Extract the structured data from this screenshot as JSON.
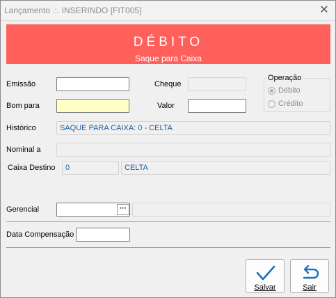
{
  "window": {
    "title": "Lançamento .:. INSERINDO [FIT005]",
    "close_glyph": "✕"
  },
  "banner": {
    "title": "DÉBITO",
    "subtitle": "Saque para Caixa",
    "color": "#ff605c"
  },
  "form": {
    "emissao_label": "Emissão",
    "emissao_value": "",
    "bom_para_label": "Bom para",
    "bom_para_value": "",
    "cheque_label": "Cheque",
    "cheque_value": "",
    "valor_label": "Valor",
    "valor_value": "",
    "historico_label": "Histórico",
    "historico_value": "SAQUE PARA CAIXA: 0 - CELTA",
    "nominal_label": "Nominal a",
    "nominal_value": "",
    "caixa_destino_label": "Caixa Destino",
    "caixa_destino_code": "0",
    "caixa_destino_name": "CELTA",
    "gerencial_label": "Gerencial",
    "gerencial_value": "",
    "gerencial_lookup_glyph": "···",
    "gerencial_desc": "",
    "data_compensacao_label": "Data Compensação",
    "data_compensacao_value": ""
  },
  "operacao": {
    "title": "Operação",
    "options": [
      {
        "label": "Débito",
        "selected": true,
        "enabled": false
      },
      {
        "label": "Crédito",
        "selected": false,
        "enabled": false
      }
    ]
  },
  "buttons": {
    "salvar_label": "Salvar",
    "sair_label": "Sair",
    "salvar_icon": "checkmark-icon",
    "sair_icon": "return-arrow-icon",
    "accent": "#1f6fbf"
  }
}
